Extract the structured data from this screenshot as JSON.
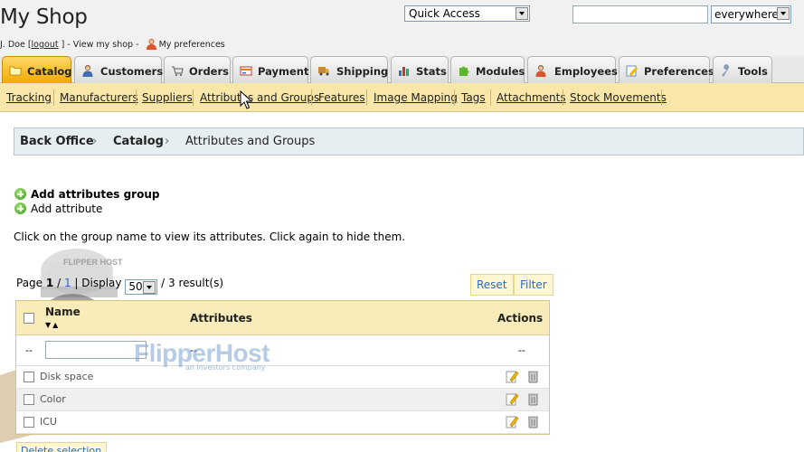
{
  "header": {
    "shop_title": "My Shop",
    "user_prefix": "J. Doe [",
    "logout": "logout",
    "user_mid": "] - View my shop -",
    "preferences": "My preferences",
    "quick_access": "Quick Access",
    "search_value": "",
    "search_scope": "everywhere"
  },
  "tabs": [
    {
      "label": "Catalog",
      "icon": "folder-icon",
      "active": true
    },
    {
      "label": "Customers",
      "icon": "person-icon"
    },
    {
      "label": "Orders",
      "icon": "cart-icon"
    },
    {
      "label": "Payment",
      "icon": "payment-icon"
    },
    {
      "label": "Shipping",
      "icon": "truck-icon"
    },
    {
      "label": "Stats",
      "icon": "bar-chart-icon"
    },
    {
      "label": "Modules",
      "icon": "puzzle-icon"
    },
    {
      "label": "Employees",
      "icon": "person-icon"
    },
    {
      "label": "Preferences",
      "icon": "edit-form-icon"
    },
    {
      "label": "Tools",
      "icon": "wrench-icon"
    }
  ],
  "subnav": [
    "Tracking",
    "Manufacturers",
    "Suppliers",
    "Attributes and Groups",
    "Features",
    "Image Mapping",
    "Tags",
    "Attachments",
    "Stock Movements"
  ],
  "breadcrumb": [
    "Back Office",
    "Catalog",
    "Attributes and Groups"
  ],
  "actions": {
    "add_group": "Add attributes group",
    "add_attribute": "Add attribute"
  },
  "hint": "Click on the group name to view its attributes. Click again to hide them.",
  "pager": {
    "page_label": "Page",
    "page": "1",
    "slash": "/",
    "total_pages": "1",
    "display_label": "| Display",
    "per_page": "50",
    "results": "/ 3 result(s)"
  },
  "buttons": {
    "reset": "Reset",
    "filter": "Filter"
  },
  "grid": {
    "col_name": "Name",
    "col_attributes": "Attributes",
    "col_actions": "Actions",
    "filter_placeholder_left": "--",
    "filter_attributes": "--",
    "filter_actions": "--",
    "rows": [
      "Disk space",
      "Color",
      "ICU"
    ]
  },
  "watermark": {
    "brand": "FlipperHost",
    "tagline": "an investors company",
    "cap_text": "FLIPPER HOST"
  },
  "bottom_button": "Delete selection",
  "colors": {
    "tab_active": "#f2a900",
    "subnav_bg": "#f8e7a8",
    "breadcrumb_bg": "#e6eef2",
    "grid_header_bg": "#f9ecbb",
    "link_blue": "#2e6db0"
  }
}
